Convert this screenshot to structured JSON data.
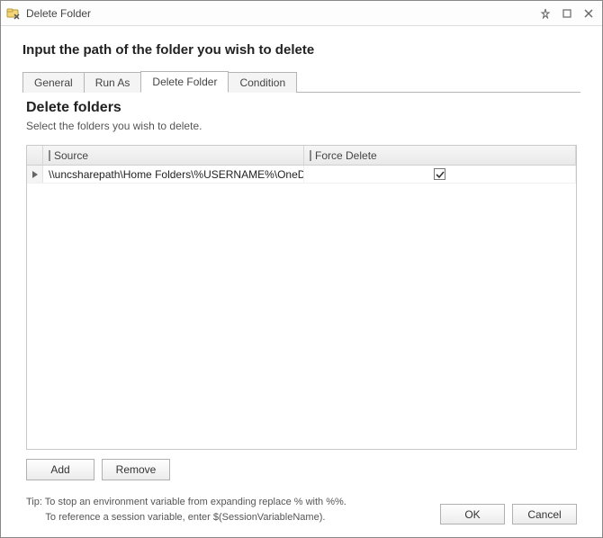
{
  "window": {
    "title": "Delete Folder"
  },
  "heading": "Input the path of the folder you wish to delete",
  "tabs": {
    "items": [
      {
        "label": "General"
      },
      {
        "label": "Run As"
      },
      {
        "label": "Delete Folder"
      },
      {
        "label": "Condition"
      }
    ],
    "active_index": 2
  },
  "panel": {
    "subheading": "Delete folders",
    "subdesc": "Select the folders you wish to delete."
  },
  "grid": {
    "columns": {
      "source": "Source",
      "force_delete": "Force Delete"
    },
    "rows": [
      {
        "source": "\\\\uncsharepath\\Home Folders\\%USERNAME%\\OneDrive...",
        "force_delete": true
      }
    ]
  },
  "buttons": {
    "add": "Add",
    "remove": "Remove",
    "ok": "OK",
    "cancel": "Cancel"
  },
  "tip": {
    "line1": "Tip: To stop an environment variable from expanding replace % with %%.",
    "line2": "To reference a session variable, enter $(SessionVariableName)."
  }
}
